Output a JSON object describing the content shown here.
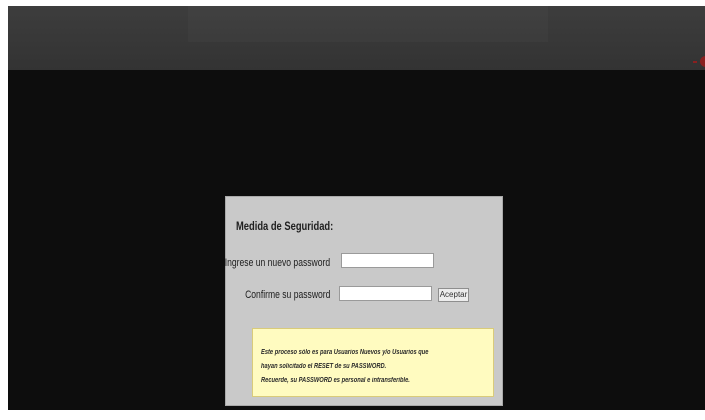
{
  "colors": {
    "page_background": "#0d0d0d",
    "top_bar": "#383838",
    "dialog_background": "#c9c9c9",
    "notice_background": "#fffbc0",
    "notice_border": "#d9cb7a",
    "accent_dot": "#8a2020"
  },
  "dialog": {
    "title": "Medida de Seguridad:",
    "new_password": {
      "label": "Ingrese un nuevo password",
      "value": ""
    },
    "confirm_password": {
      "label": "Confirme su password",
      "value": ""
    },
    "accept_label": "Aceptar",
    "notice_lines": [
      "Este proceso sólo es para Usuarios Nuevos y/o Usuarios que",
      "hayan solicitado el RESET de su PASSWORD.",
      "Recuerde, su PASSWORD es personal e intransferible."
    ]
  }
}
